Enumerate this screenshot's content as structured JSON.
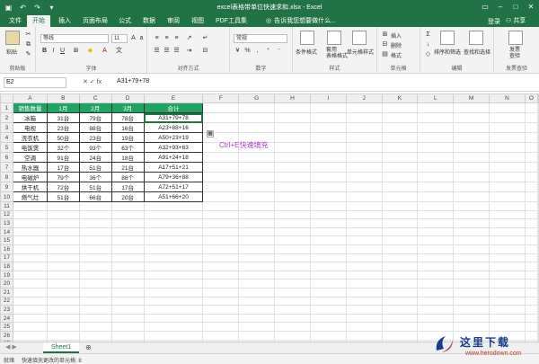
{
  "title": "excel表格带单位快速求和.xlsx - Excel",
  "tabs": [
    "文件",
    "开始",
    "插入",
    "页面布局",
    "公式",
    "数据",
    "审阅",
    "视图",
    "PDF工具集"
  ],
  "active_tab_index": 1,
  "tell_me": "告诉我您想要做什么...",
  "login": "登录",
  "share": "共享",
  "ribbon": {
    "font_name": "等线",
    "font_size": "11",
    "number_format": "常规",
    "paste": "粘贴",
    "cond_format": "条件格式",
    "table_format": "套用\n表格格式",
    "cell_style": "单元格样式",
    "insert": "插入",
    "delete": "删除",
    "format": "格式",
    "sort_filter": "排序和筛选",
    "find_select": "查找和选择",
    "invoice": "发票\n查验",
    "groups": [
      "剪贴板",
      "字体",
      "对齐方式",
      "数字",
      "样式",
      "单元格",
      "编辑",
      "发票查验"
    ]
  },
  "name_box": "E2",
  "formula": "A31+79+78",
  "columns": [
    "A",
    "B",
    "C",
    "D",
    "E",
    "F",
    "G",
    "H",
    "I",
    "J",
    "K",
    "L",
    "M",
    "N",
    "O"
  ],
  "header_row": [
    "销售数量",
    "1月",
    "2月",
    "3月",
    "合计"
  ],
  "rows": [
    [
      "冰箱",
      "31台",
      "79台",
      "78台",
      "A31+79+78"
    ],
    [
      "电视",
      "23台",
      "88台",
      "16台",
      "A23+88+16"
    ],
    [
      "洗衣机",
      "50台",
      "23台",
      "19台",
      "A50+23+19"
    ],
    [
      "电饭煲",
      "32个",
      "93个",
      "63个",
      "A32+93+63"
    ],
    [
      "空调",
      "91台",
      "24台",
      "18台",
      "A91+24+18"
    ],
    [
      "热水器",
      "17台",
      "51台",
      "21台",
      "A17+51+21"
    ],
    [
      "电磁炉",
      "79个",
      "36个",
      "88个",
      "A79+36+88"
    ],
    [
      "烘干机",
      "72台",
      "51台",
      "17台",
      "A72+51+17"
    ],
    [
      "燃气灶",
      "51台",
      "66台",
      "20台",
      "A51+66+20"
    ]
  ],
  "total_rows": 28,
  "annotation": "Ctrl+E快速填充",
  "sheet_tab": "Sheet1",
  "status": {
    "ready": "就绪",
    "message": "快速填充更改的单元格: 8"
  },
  "watermark": {
    "cn": "这里下载",
    "en": "www.herodown.com"
  },
  "colors": {
    "excel_green": "#217346",
    "header_fill": "#21a365",
    "annotation": "#b23bd9"
  }
}
